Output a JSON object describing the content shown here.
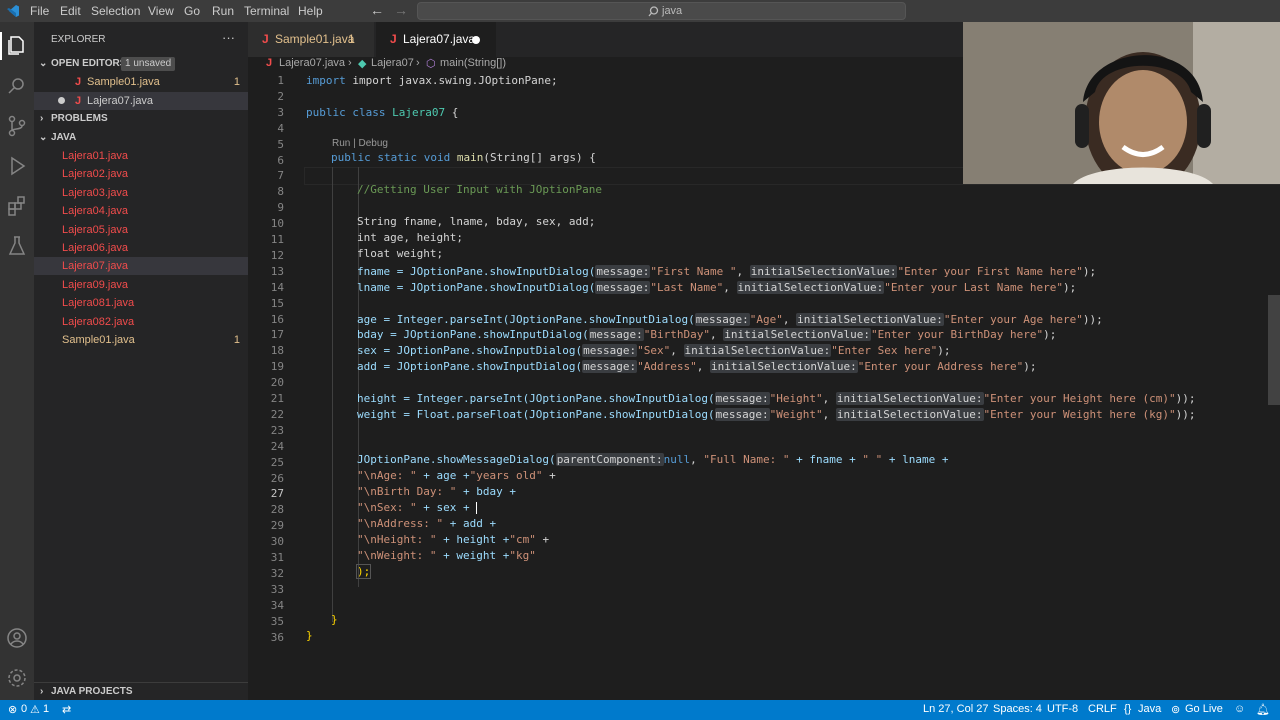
{
  "menu": [
    "File",
    "Edit",
    "Selection",
    "View",
    "Go",
    "Run",
    "Terminal",
    "Help"
  ],
  "search": {
    "placeholder": "java"
  },
  "sidebar": {
    "title": "EXPLORER",
    "open_editors": {
      "label": "OPEN EDITORS",
      "badge": "1 unsaved",
      "items": [
        {
          "name": "Sample01.java",
          "count": "1"
        },
        {
          "name": "Lajera07.java",
          "count": ""
        }
      ]
    },
    "problems": "PROBLEMS",
    "folder": "JAVA",
    "files": [
      {
        "name": "Lajera01.java",
        "count": ""
      },
      {
        "name": "Lajera02.java",
        "count": ""
      },
      {
        "name": "Lajera03.java",
        "count": ""
      },
      {
        "name": "Lajera04.java",
        "count": ""
      },
      {
        "name": "Lajera05.java",
        "count": ""
      },
      {
        "name": "Lajera06.java",
        "count": ""
      },
      {
        "name": "Lajera07.java",
        "count": ""
      },
      {
        "name": "Lajera09.java",
        "count": ""
      },
      {
        "name": "Lajera081.java",
        "count": ""
      },
      {
        "name": "Lajera082.java",
        "count": ""
      },
      {
        "name": "Sample01.java",
        "count": "1"
      }
    ],
    "java_projects": "JAVA PROJECTS"
  },
  "tabs": [
    {
      "label": "Sample01.java",
      "count": "1"
    },
    {
      "label": "Lajera07.java",
      "count": ""
    }
  ],
  "breadcrumb": {
    "file": "Lajera07.java",
    "cls": "Lajera07",
    "method": "main(String[])"
  },
  "codelens": "Run | Debug",
  "line_numbers": [
    "1",
    "2",
    "3",
    "4",
    "5",
    "6",
    "7",
    "8",
    "9",
    "10",
    "11",
    "12",
    "13",
    "14",
    "15",
    "16",
    "17",
    "18",
    "19",
    "20",
    "21",
    "22",
    "23",
    "24",
    "25",
    "26",
    "27",
    "28",
    "29",
    "30",
    "31",
    "32",
    "33",
    "34",
    "35",
    "36"
  ],
  "code": {
    "l1": "import javax.swing.JOptionPane;",
    "l3a": "public class ",
    "l3b": "Lajera07",
    "l3c": " {",
    "l5a": "public static void ",
    "l5b": "main",
    "l5c": "(String[] args) {",
    "l7": "//Getting User Input with JOptionPane",
    "l9": "String fname, lname, bday, sex, add;",
    "l10": "int age, height;",
    "l11": "float weight;",
    "l13": [
      "fname = JOptionPane.showInputDialog(",
      "message:",
      "\"First Name \"",
      ", ",
      "initialSelectionValue:",
      "\"Enter your First Name here\"",
      ");"
    ],
    "l14": [
      "lname = JOptionPane.showInputDialog(",
      "message:",
      "\"Last Name\"",
      ", ",
      "initialSelectionValue:",
      "\"Enter your Last Name here\"",
      ");"
    ],
    "l16": [
      "age = Integer.parseInt(JOptionPane.showInputDialog(",
      "message:",
      "\"Age\"",
      ", ",
      "initialSelectionValue:",
      "\"Enter your Age here\"",
      "));"
    ],
    "l17": [
      "bday = JOptionPane.showInputDialog(",
      "message:",
      "\"BirthDay\"",
      ", ",
      "initialSelectionValue:",
      "\"Enter your BirthDay here\"",
      ");"
    ],
    "l18": [
      "sex = JOptionPane.showInputDialog(",
      "message:",
      "\"Sex\"",
      ", ",
      "initialSelectionValue:",
      "\"Enter Sex here\"",
      ");"
    ],
    "l19": [
      "add = JOptionPane.showInputDialog(",
      "message:",
      "\"Address\"",
      ", ",
      "initialSelectionValue:",
      "\"Enter your Address here\"",
      ");"
    ],
    "l21": [
      "height = Integer.parseInt(JOptionPane.showInputDialog(",
      "message:",
      "\"Height\"",
      ", ",
      "initialSelectionValue:",
      "\"Enter your Height here (cm)\"",
      "));"
    ],
    "l22": [
      "weight = Float.parseFloat(JOptionPane.showInputDialog(",
      "message:",
      "\"Weight\"",
      ", ",
      "initialSelectionValue:",
      "\"Enter your Weight here (kg)\"",
      "));"
    ],
    "l24": [
      "JOptionPane.showMessageDialog(",
      "parentComponent:",
      "null",
      ", ",
      "\"Full Name: \"",
      " + fname + ",
      "\" \"",
      " + lname +"
    ],
    "l25": [
      "\"\\nAge: \"",
      " + age +",
      "\"years old\"",
      " +"
    ],
    "l26": [
      "\"\\nBirth Day: \"",
      " + bday +"
    ],
    "l27": [
      "\"\\nSex: \"",
      " + sex + "
    ],
    "l28": [
      "\"\\nAddress: \"",
      " + add +"
    ],
    "l29": [
      "\"\\nHeight: \"",
      " + height +",
      "\"cm\"",
      " +"
    ],
    "l30": [
      "\"\\nWeight: \"",
      " + weight +",
      "\"kg\""
    ],
    "l31": ");",
    "l34": "}",
    "l35": "}"
  },
  "status": {
    "errors": "0",
    "warnings": "1",
    "position": "Ln 27, Col 27",
    "spaces": "Spaces: 4",
    "encoding": "UTF-8",
    "eol": "CRLF",
    "language": "Java",
    "golive": "Go Live"
  },
  "colors": {
    "accent": "#007acc",
    "error": "#f14c4c",
    "modified": "#e2c08d"
  }
}
